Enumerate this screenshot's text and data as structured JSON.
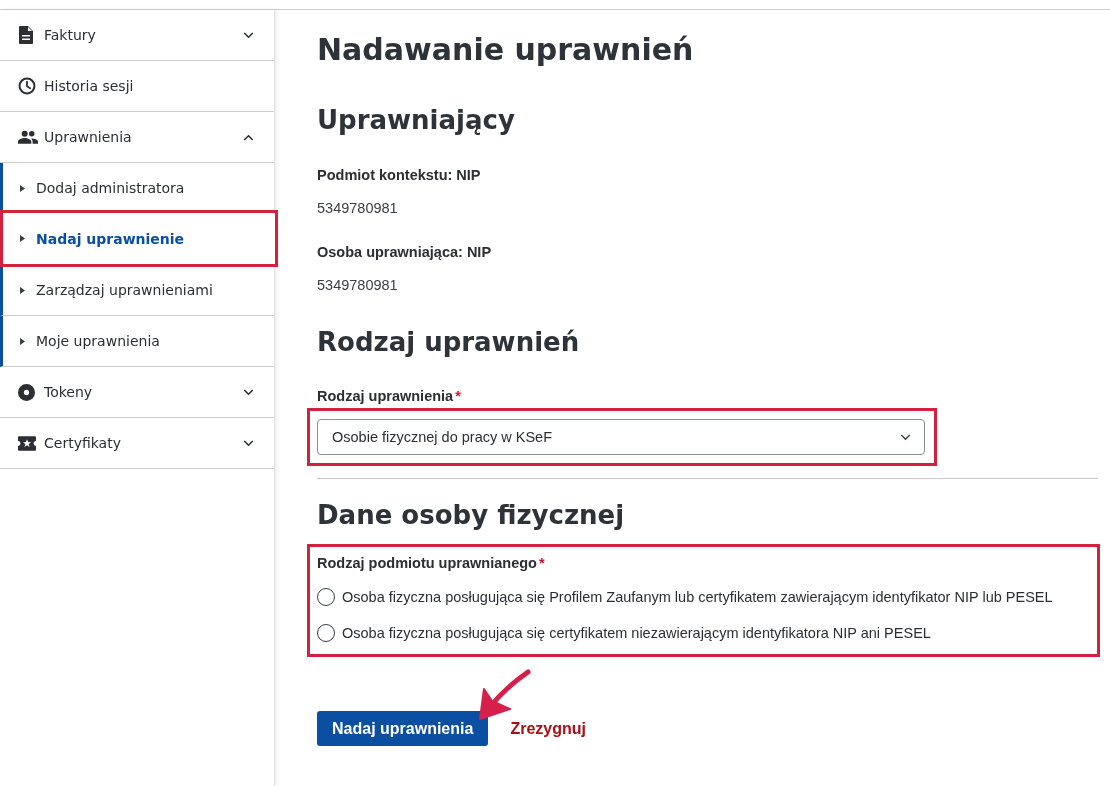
{
  "sidebar": {
    "items": [
      {
        "label": "Faktury",
        "kind": "group",
        "expanded": false
      },
      {
        "label": "Historia sesji",
        "kind": "link"
      },
      {
        "label": "Uprawnienia",
        "kind": "group",
        "expanded": true,
        "children": [
          {
            "label": "Dodaj administratora",
            "selected": false,
            "highlighted": false
          },
          {
            "label": "Nadaj uprawnienie",
            "selected": true,
            "highlighted": true
          },
          {
            "label": "Zarządzaj uprawnieniami",
            "selected": false,
            "highlighted": false
          },
          {
            "label": "Moje uprawnienia",
            "selected": false,
            "highlighted": false
          }
        ]
      },
      {
        "label": "Tokeny",
        "kind": "group",
        "expanded": false
      },
      {
        "label": "Certyfikaty",
        "kind": "group",
        "expanded": false
      }
    ]
  },
  "page_title": "Nadawanie uprawnień",
  "grantor": {
    "heading": "Uprawniający",
    "fields": [
      {
        "label": "Podmiot kontekstu: NIP",
        "value": "5349780981"
      },
      {
        "label": "Osoba uprawniająca: NIP",
        "value": "5349780981"
      }
    ]
  },
  "permission_type": {
    "heading": "Rodzaj uprawnień",
    "select": {
      "label": "Rodzaj uprawnienia",
      "required_mark": "*",
      "value": "Osobie fizycznej do pracy w KSeF",
      "highlighted": true
    }
  },
  "person_data": {
    "heading": "Dane osoby fizycznej",
    "radio_group": {
      "label": "Rodzaj podmiotu uprawnianego",
      "required_mark": "*",
      "highlighted": true,
      "options": [
        {
          "label": "Osoba fizyczna posługująca się Profilem Zaufanym lub certyfikatem zawierającym identyfikator NIP lub PESEL",
          "selected": false
        },
        {
          "label": "Osoba fizyczna posługująca się certyfikatem niezawierającym identyfikatora NIP ani PESEL",
          "selected": false
        }
      ]
    }
  },
  "submit_button": {
    "label": "Nadaj uprawnienia",
    "pointed": true
  },
  "cancel_link": {
    "label": "Zrezygnuj"
  }
}
